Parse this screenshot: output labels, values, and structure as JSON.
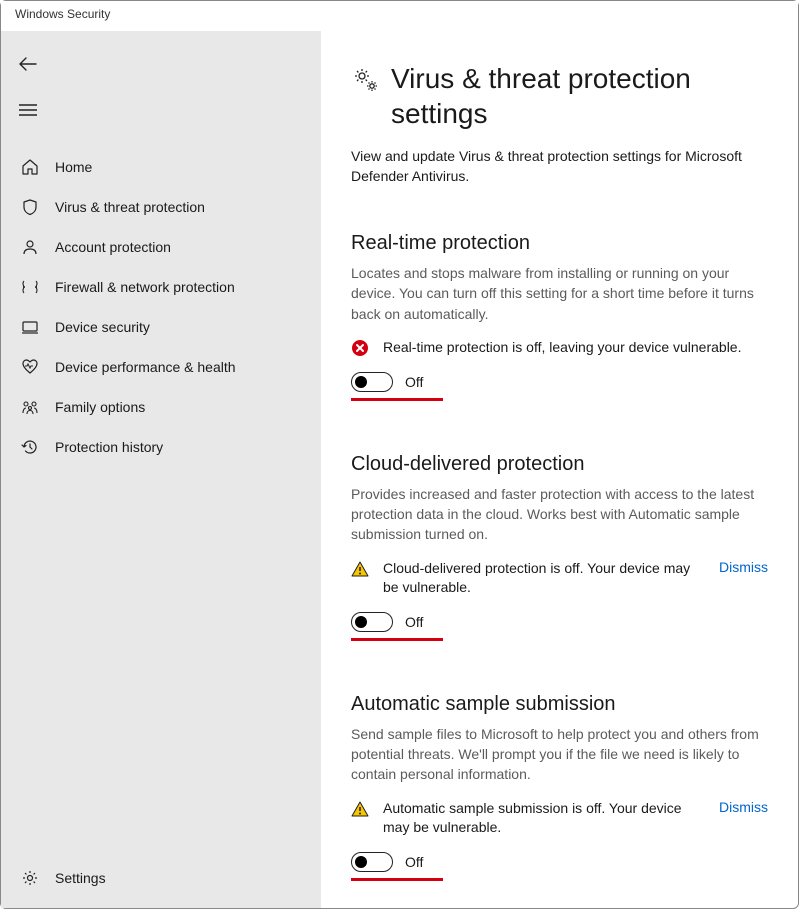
{
  "window": {
    "title": "Windows Security"
  },
  "sidebar": {
    "items": [
      {
        "label": "Home"
      },
      {
        "label": "Virus & threat protection"
      },
      {
        "label": "Account protection"
      },
      {
        "label": "Firewall & network protection"
      },
      {
        "label": "Device security"
      },
      {
        "label": "Device performance & health"
      },
      {
        "label": "Family options"
      },
      {
        "label": "Protection history"
      }
    ],
    "settings_label": "Settings"
  },
  "page": {
    "title": "Virus & threat protection settings",
    "description": "View and update Virus & threat protection settings for Microsoft Defender Antivirus."
  },
  "sections": {
    "realtime": {
      "title": "Real-time protection",
      "description": "Locates and stops malware from installing or running on your device. You can turn off this setting for a short time before it turns back on automatically.",
      "alert_text": "Real-time protection is off, leaving your device vulnerable.",
      "toggle_state": "Off"
    },
    "cloud": {
      "title": "Cloud-delivered protection",
      "description": "Provides increased and faster protection with access to the latest protection data in the cloud. Works best with Automatic sample submission turned on.",
      "alert_text": "Cloud-delivered protection is off. Your device may be vulnerable.",
      "dismiss_label": "Dismiss",
      "toggle_state": "Off"
    },
    "sample": {
      "title": "Automatic sample submission",
      "description": "Send sample files to Microsoft to help protect you and others from potential threats. We'll prompt you if the file we need is likely to contain personal information.",
      "alert_text": "Automatic sample submission is off. Your device may be vulnerable.",
      "dismiss_label": "Dismiss",
      "toggle_state": "Off"
    }
  }
}
